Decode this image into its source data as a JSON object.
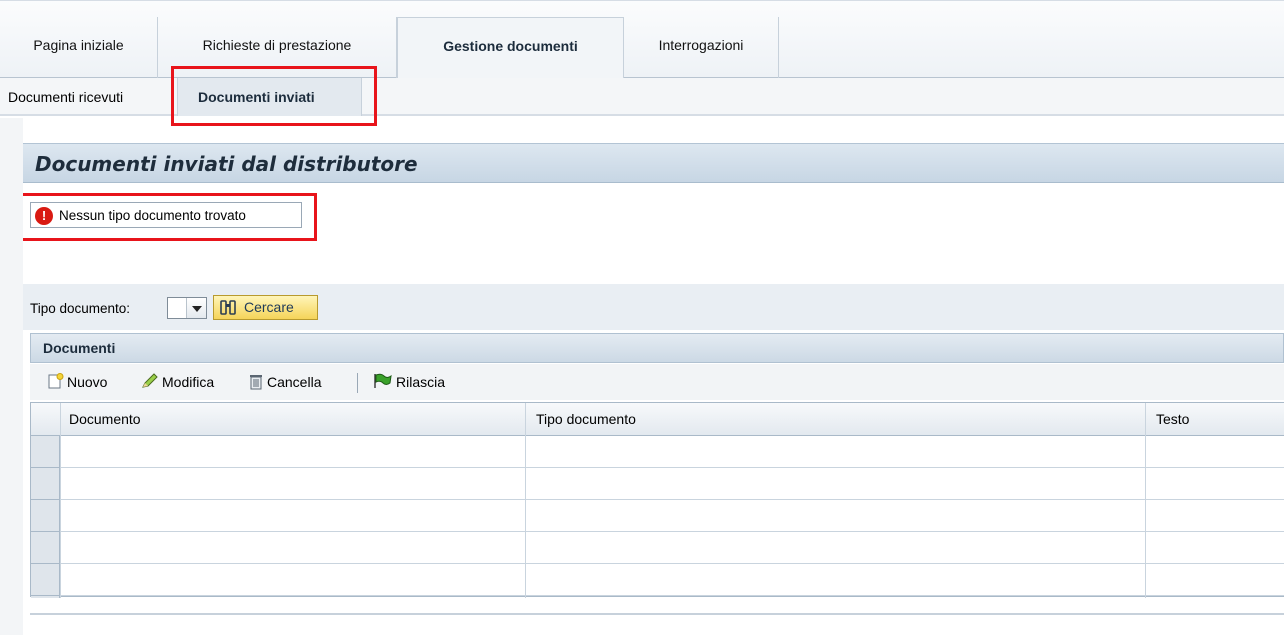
{
  "top_tabs": [
    {
      "label": "Pagina iniziale"
    },
    {
      "label": "Richieste di prestazione"
    },
    {
      "label": "Gestione documenti"
    },
    {
      "label": "Interrogazioni"
    }
  ],
  "sub_tabs": [
    {
      "label": "Documenti ricevuti"
    },
    {
      "label": "Documenti inviati"
    }
  ],
  "page": {
    "title": "Documenti inviati dal distributore"
  },
  "message": {
    "text": "Nessun tipo documento trovato",
    "icon": "error-icon"
  },
  "search": {
    "label": "Tipo documento:",
    "selected_value": "",
    "button_label": "Cercare"
  },
  "documents": {
    "section_title": "Documenti",
    "toolbar": {
      "new_label": "Nuovo",
      "edit_label": "Modifica",
      "delete_label": "Cancella",
      "release_label": "Rilascia"
    },
    "columns": [
      "Documento",
      "Tipo documento",
      "Testo"
    ],
    "rows": [
      [
        "",
        "",
        ""
      ],
      [
        "",
        "",
        ""
      ],
      [
        "",
        "",
        ""
      ],
      [
        "",
        "",
        ""
      ],
      [
        "",
        "",
        ""
      ]
    ]
  },
  "colors": {
    "highlight": "#e8141b",
    "header_blue": "#c7d6e4",
    "button_yellow": "#f5d45a"
  }
}
